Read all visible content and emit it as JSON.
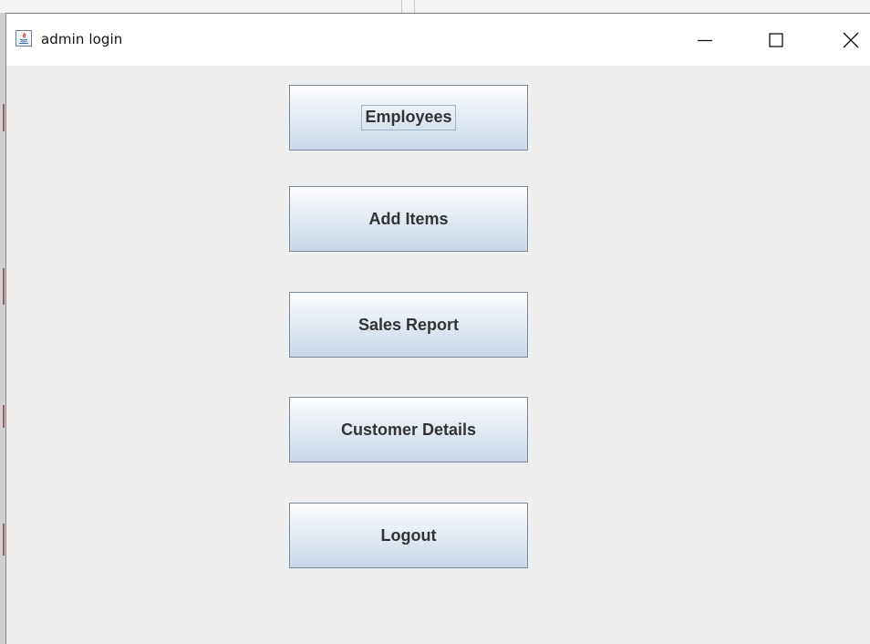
{
  "window": {
    "title": "admin login",
    "icon": "java-icon",
    "controls": {
      "minimize_icon": "minimize-icon",
      "maximize_icon": "maximize-icon",
      "close_icon": "close-icon"
    }
  },
  "menu": {
    "buttons": [
      {
        "label": "Employees",
        "focused": true
      },
      {
        "label": "Add Items"
      },
      {
        "label": "Sales Report"
      },
      {
        "label": "Customer Details"
      },
      {
        "label": "Logout"
      }
    ]
  },
  "colors": {
    "content_bg": "#eeeeee",
    "titlebar_bg": "#ffffff",
    "button_border": "#7a8a99",
    "button_gradient_top": "#ffffff",
    "button_gradient_bottom": "#c9d7e6",
    "button_text": "#333333"
  }
}
